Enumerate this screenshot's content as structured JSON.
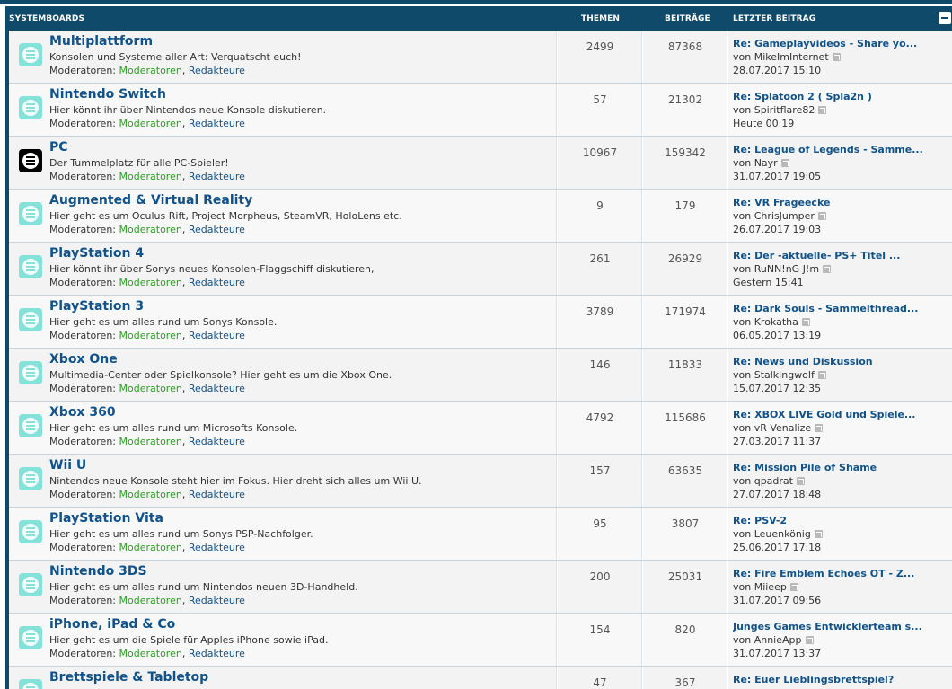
{
  "header": {
    "boards": "SYSTEMBOARDS",
    "themen": "THEMEN",
    "beitraege": "BEITRÄGE",
    "letzter": "LETZTER BEITRAG"
  },
  "mods_prefix": "Moderatoren:",
  "mods_group1": "Moderatoren",
  "mods_sep": ",",
  "mods_group2": "Redakteure",
  "forums": [
    {
      "title": "Multiplattform",
      "desc": "Konsolen und Systeme aller Art: Verquatscht euch!",
      "themen": "2499",
      "beitraege": "87368",
      "last_title": "Re: Gameplayvideos - Share yo...",
      "last_by": "von MikeImInternet",
      "last_date": "28.07.2017 15:10",
      "icon": "forum-unread-icon"
    },
    {
      "title": "Nintendo Switch",
      "desc": "Hier könnt ihr über Nintendos neue Konsole diskutieren.",
      "themen": "57",
      "beitraege": "21302",
      "last_title": "Re: Splatoon 2 ( Spla2n )",
      "last_by": "von Spiritflare82",
      "last_date": "Heute 00:19",
      "icon": "forum-unread-icon"
    },
    {
      "title": "PC",
      "desc": "Der Tummelplatz für alle PC-Spieler!",
      "themen": "10967",
      "beitraege": "159342",
      "last_title": "Re: League of Legends - Samme...",
      "last_by": "von Nayr",
      "last_date": "31.07.2017 19:05",
      "icon": "forum-read-icon"
    },
    {
      "title": "Augmented & Virtual Reality",
      "desc": "Hier geht es um Oculus Rift, Project Morpheus, SteamVR, HoloLens etc.",
      "themen": "9",
      "beitraege": "179",
      "last_title": "Re: VR Frageecke",
      "last_by": "von ChrisJumper",
      "last_date": "26.07.2017 19:03",
      "icon": "forum-unread-icon"
    },
    {
      "title": "PlayStation 4",
      "desc": "Hier könnt ihr über Sonys neues Konsolen-Flaggschiff diskutieren,",
      "themen": "261",
      "beitraege": "26929",
      "last_title": "Re: Der -aktuelle- PS+ Titel ...",
      "last_by": "von RuNN!nG J!m",
      "last_date": "Gestern 15:41",
      "icon": "forum-unread-icon"
    },
    {
      "title": "PlayStation 3",
      "desc": "Hier geht es um alles rund um Sonys Konsole.",
      "themen": "3789",
      "beitraege": "171974",
      "last_title": "Re: Dark Souls - Sammelthread...",
      "last_by": "von Krokatha",
      "last_date": "06.05.2017 13:19",
      "icon": "forum-unread-icon"
    },
    {
      "title": "Xbox One",
      "desc": "Multimedia-Center oder Spielkonsole? Hier geht es um die Xbox One.",
      "themen": "146",
      "beitraege": "11833",
      "last_title": "Re: News und Diskussion",
      "last_by": "von Stalkingwolf",
      "last_date": "15.07.2017 12:35",
      "icon": "forum-unread-icon"
    },
    {
      "title": "Xbox 360",
      "desc": "Hier geht es um alles rund um Microsofts Konsole.",
      "themen": "4792",
      "beitraege": "115686",
      "last_title": "Re: XBOX LIVE Gold und Spiele...",
      "last_by": "von vR Venalize",
      "last_date": "27.03.2017 11:37",
      "icon": "forum-unread-icon"
    },
    {
      "title": "Wii U",
      "desc": "Nintendos neue Konsole steht hier im Fokus. Hier dreht sich alles um Wii U.",
      "themen": "157",
      "beitraege": "63635",
      "last_title": "Re: Mission Pile of Shame",
      "last_by": "von qpadrat",
      "last_date": "27.07.2017 18:48",
      "icon": "forum-unread-icon"
    },
    {
      "title": "PlayStation Vita",
      "desc": "Hier geht es um alles rund um Sonys PSP-Nachfolger.",
      "themen": "95",
      "beitraege": "3807",
      "last_title": "Re: PSV-2",
      "last_by": "von Leuenkönig",
      "last_date": "25.06.2017 17:18",
      "icon": "forum-unread-icon"
    },
    {
      "title": "Nintendo 3DS",
      "desc": "Hier geht es um alles rund um Nintendos neuen 3D-Handheld.",
      "themen": "200",
      "beitraege": "25031",
      "last_title": "Re: Fire Emblem Echoes OT - Z...",
      "last_by": "von Miieep",
      "last_date": "31.07.2017 09:56",
      "icon": "forum-unread-icon"
    },
    {
      "title": "iPhone, iPad & Co",
      "desc": "Hier geht es um die Spiele für Apples iPhone sowie iPad.",
      "themen": "154",
      "beitraege": "820",
      "last_title": "Junges Games Entwicklerteam s...",
      "last_by": "von AnnieApp",
      "last_date": "31.07.2017 13:37",
      "icon": "forum-unread-icon"
    },
    {
      "title": "Brettspiele & Tabletop",
      "desc": "",
      "themen": "47",
      "beitraege": "367",
      "last_title": "Re: Euer Lieblingsbrettspiel?",
      "last_by": "",
      "last_date": "",
      "icon": "forum-unread-icon"
    }
  ]
}
